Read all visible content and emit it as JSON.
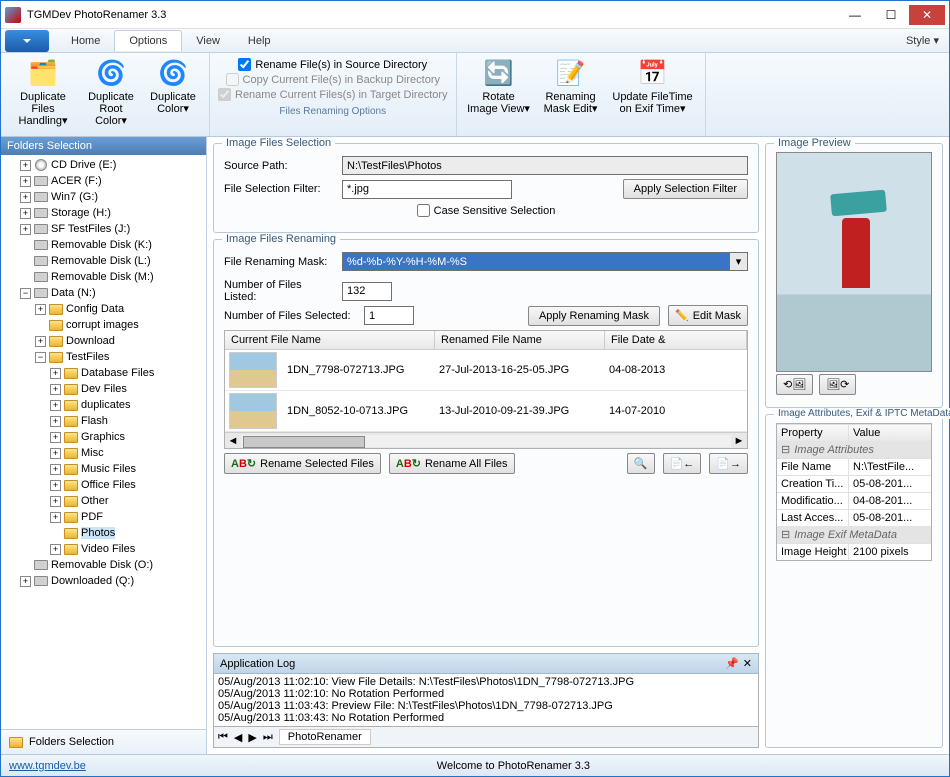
{
  "title": "TGMDev PhotoRenamer 3.3",
  "menuTabs": {
    "home": "Home",
    "options": "Options",
    "view": "View",
    "help": "Help",
    "style": "Style"
  },
  "ribbon": {
    "dupFiles": "Duplicate Files\nHandling",
    "dupRoot": "Duplicate\nRoot Color",
    "dupColor": "Duplicate\nColor",
    "chkRenameSource": "Rename File(s) in Source Directory",
    "chkCopyBackup": "Copy Current File(s) in Backup Directory",
    "chkRenameTarget": "Rename Current Files(s) in Target Directory",
    "optsCaption": "Files Renaming Options",
    "rotate": "Rotate\nImage View",
    "maskEdit": "Renaming\nMask Edit",
    "fileTime": "Update FileTime\non Exif Time"
  },
  "sidebar": {
    "title": "Folders Selection",
    "nodes": [
      {
        "indent": 1,
        "tog": "+",
        "ico": "cd",
        "label": "CD Drive (E:)"
      },
      {
        "indent": 1,
        "tog": "+",
        "ico": "drive",
        "label": "ACER (F:)"
      },
      {
        "indent": 1,
        "tog": "+",
        "ico": "drive",
        "label": "Win7 (G:)"
      },
      {
        "indent": 1,
        "tog": "+",
        "ico": "drive",
        "label": "Storage (H:)"
      },
      {
        "indent": 1,
        "tog": "+",
        "ico": "drive",
        "label": "SF TestFiles (J:)"
      },
      {
        "indent": 1,
        "tog": "",
        "ico": "drive",
        "label": "Removable Disk (K:)"
      },
      {
        "indent": 1,
        "tog": "",
        "ico": "drive",
        "label": "Removable Disk (L:)"
      },
      {
        "indent": 1,
        "tog": "",
        "ico": "drive",
        "label": "Removable Disk (M:)"
      },
      {
        "indent": 1,
        "tog": "−",
        "ico": "drive",
        "label": "Data (N:)"
      },
      {
        "indent": 2,
        "tog": "+",
        "ico": "folder",
        "label": "Config Data"
      },
      {
        "indent": 2,
        "tog": "",
        "ico": "folder",
        "label": "corrupt images"
      },
      {
        "indent": 2,
        "tog": "+",
        "ico": "folder",
        "label": "Download"
      },
      {
        "indent": 2,
        "tog": "−",
        "ico": "folder",
        "label": "TestFiles"
      },
      {
        "indent": 3,
        "tog": "+",
        "ico": "folder",
        "label": "Database Files"
      },
      {
        "indent": 3,
        "tog": "+",
        "ico": "folder",
        "label": "Dev Files"
      },
      {
        "indent": 3,
        "tog": "+",
        "ico": "folder",
        "label": "duplicates"
      },
      {
        "indent": 3,
        "tog": "+",
        "ico": "folder",
        "label": "Flash"
      },
      {
        "indent": 3,
        "tog": "+",
        "ico": "folder",
        "label": "Graphics"
      },
      {
        "indent": 3,
        "tog": "+",
        "ico": "folder",
        "label": "Misc"
      },
      {
        "indent": 3,
        "tog": "+",
        "ico": "folder",
        "label": "Music Files"
      },
      {
        "indent": 3,
        "tog": "+",
        "ico": "folder",
        "label": "Office Files"
      },
      {
        "indent": 3,
        "tog": "+",
        "ico": "folder",
        "label": "Other"
      },
      {
        "indent": 3,
        "tog": "+",
        "ico": "folder",
        "label": "PDF"
      },
      {
        "indent": 3,
        "tog": "",
        "ico": "folder",
        "label": "Photos",
        "selected": true
      },
      {
        "indent": 3,
        "tog": "+",
        "ico": "folder",
        "label": "Video Files"
      },
      {
        "indent": 1,
        "tog": "",
        "ico": "drive",
        "label": "Removable Disk (O:)"
      },
      {
        "indent": 1,
        "tog": "+",
        "ico": "drive",
        "label": "Downloaded (Q:)"
      }
    ],
    "foot": "Folders Selection"
  },
  "selGroup": {
    "title": "Image Files Selection",
    "sourcePathLabel": "Source Path:",
    "sourcePath": "N:\\TestFiles\\Photos",
    "filterLabel": "File Selection Filter:",
    "filter": "*.jpg",
    "applyFilter": "Apply Selection Filter",
    "caseSensitive": "Case Sensitive Selection"
  },
  "renGroup": {
    "title": "Image Files Renaming",
    "maskLabel": "File Renaming Mask:",
    "mask": "%d-%b-%Y-%H-%M-%S",
    "listedLabel": "Number of Files Listed:",
    "listed": "132",
    "selectedLabel": "Number of Files Selected:",
    "selected": "1",
    "applyMask": "Apply Renaming Mask",
    "editMask": "Edit Mask",
    "cols": {
      "current": "Current File Name",
      "renamed": "Renamed File Name",
      "date": "File Date & "
    },
    "rows": [
      {
        "current": "1DN_7798-072713.JPG",
        "renamed": "27-Jul-2013-16-25-05.JPG",
        "date": "04-08-2013"
      },
      {
        "current": "1DN_8052-10-0713.JPG",
        "renamed": "13-Jul-2010-09-21-39.JPG",
        "date": "14-07-2010"
      }
    ],
    "renameSel": "Rename Selected Files",
    "renameAll": "Rename All Files"
  },
  "preview": {
    "title": "Image Preview"
  },
  "attrs": {
    "title": "Image Attributes, Exif & IPTC MetaData",
    "colProp": "Property",
    "colVal": "Value",
    "sec1": "Image Attributes",
    "rows1": [
      {
        "k": "File Name",
        "v": "N:\\TestFile..."
      },
      {
        "k": "Creation Ti...",
        "v": "05-08-201..."
      },
      {
        "k": "Modificatio...",
        "v": "04-08-201..."
      },
      {
        "k": "Last Acces...",
        "v": "05-08-201..."
      }
    ],
    "sec2": "Image Exif MetaData",
    "rows2": [
      {
        "k": "Image Height",
        "v": "2100 pixels"
      }
    ]
  },
  "log": {
    "title": "Application Log",
    "lines": [
      "05/Aug/2013 11:02:10: View File Details: N:\\TestFiles\\Photos\\1DN_7798-072713.JPG",
      "05/Aug/2013 11:02:10: No Rotation Performed",
      "05/Aug/2013 11:03:43: Preview File: N:\\TestFiles\\Photos\\1DN_7798-072713.JPG",
      "05/Aug/2013 11:03:43: No Rotation Performed"
    ],
    "tab": "PhotoRenamer"
  },
  "status": {
    "link": "www.tgmdev.be",
    "welcome": "Welcome to PhotoRenamer 3.3"
  }
}
